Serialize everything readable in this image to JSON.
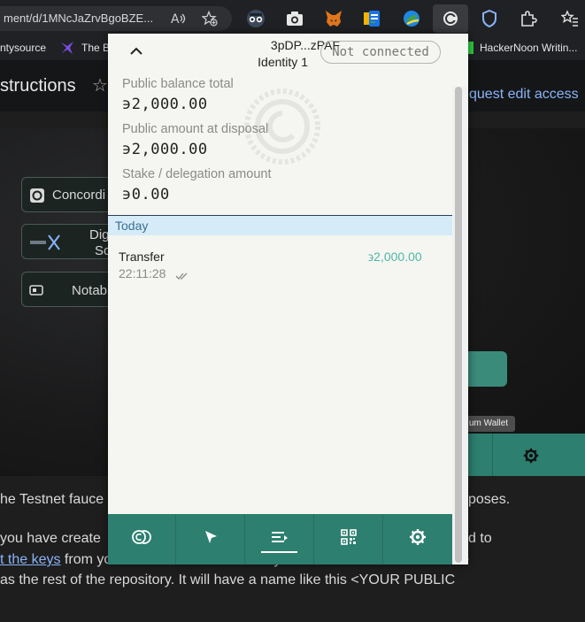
{
  "browser": {
    "url_text": "ment/d/1MNcJaZrvBgoBZE...",
    "read_aloud_icon": "A̅",
    "bookmarks": [
      {
        "label": "ntysource"
      },
      {
        "label": "The B"
      },
      {
        "label": "HackerNoon Writin..."
      }
    ]
  },
  "page": {
    "title": "structions",
    "request_edit": "quest edit access",
    "cards": [
      "Concordi",
      "Dig",
      "Solutio",
      "Notab"
    ],
    "tooltip": "um Wallet",
    "text_line1_left": "he Testnet fauce",
    "text_line1_right": "poses.",
    "text_line2_left": " you have create",
    "text_line2_right": "d to",
    "text_line3_link": "t the keys",
    "text_line3_rest": " from your wallet. Save the file on your local machine in the same",
    "text_line4": " as the rest of the repository. It will have a name like this  <YOUR PUBLIC"
  },
  "wallet": {
    "account_short": "3pDP...zPAF",
    "identity_name": "Identity 1",
    "connection_status": "Not connected",
    "balances": [
      {
        "label": "Public balance total",
        "value": "϶2,000.00"
      },
      {
        "label": "Public amount at disposal",
        "value": "϶2,000.00"
      },
      {
        "label": "Stake / delegation amount",
        "value": "϶0.00"
      }
    ],
    "section_label": "Today",
    "transactions": [
      {
        "type": "Transfer",
        "amount": "϶2,000.00",
        "time": "22:11:28",
        "status_icon": "double-check-icon"
      }
    ],
    "nav": [
      {
        "name": "nav-accounts",
        "icon": "ccd-coins-icon"
      },
      {
        "name": "nav-send",
        "icon": "cursor-send-icon"
      },
      {
        "name": "nav-transactions",
        "icon": "transaction-list-icon",
        "active": true
      },
      {
        "name": "nav-receive",
        "icon": "qr-code-icon"
      },
      {
        "name": "nav-settings",
        "icon": "gear-icon"
      }
    ],
    "colors": {
      "nav_bg": "#2d7f6f",
      "amount_positive": "#4fb6a5",
      "today_bg": "#d5ebf8",
      "today_text": "#3c6f92"
    }
  }
}
